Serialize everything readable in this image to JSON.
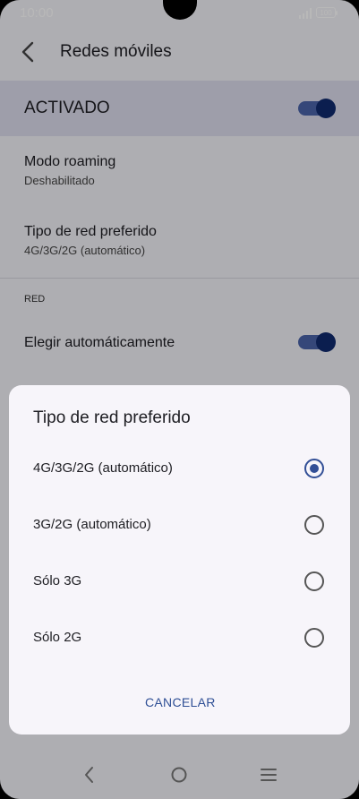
{
  "status_bar": {
    "time": "10:00",
    "battery": "100"
  },
  "app_bar": {
    "title": "Redes móviles",
    "back_icon": "chevron-left-icon"
  },
  "master_toggle": {
    "label": "ACTIVADO",
    "state": "on"
  },
  "settings": {
    "roaming": {
      "title": "Modo roaming",
      "subtitle": "Deshabilitado"
    },
    "preferred_network": {
      "title": "Tipo de red preferido",
      "subtitle": "4G/3G/2G (automático)"
    },
    "section_red": "RED",
    "auto_select": {
      "label": "Elegir automáticamente",
      "state": "on"
    }
  },
  "dialog": {
    "title": "Tipo de red preferido",
    "options": [
      {
        "label": "4G/3G/2G (automático)",
        "selected": true
      },
      {
        "label": "3G/2G (automático)",
        "selected": false
      },
      {
        "label": "Sólo 3G",
        "selected": false
      },
      {
        "label": "Sólo 2G",
        "selected": false
      }
    ],
    "cancel_label": "CANCELAR"
  },
  "nav_bar": {
    "back_icon": "nav-back-icon",
    "home_icon": "nav-home-icon",
    "menu_icon": "nav-menu-icon"
  },
  "colors": {
    "accent": "#324f96",
    "toggle_track": "#4a63a8",
    "toggle_knob": "#102a6e"
  }
}
